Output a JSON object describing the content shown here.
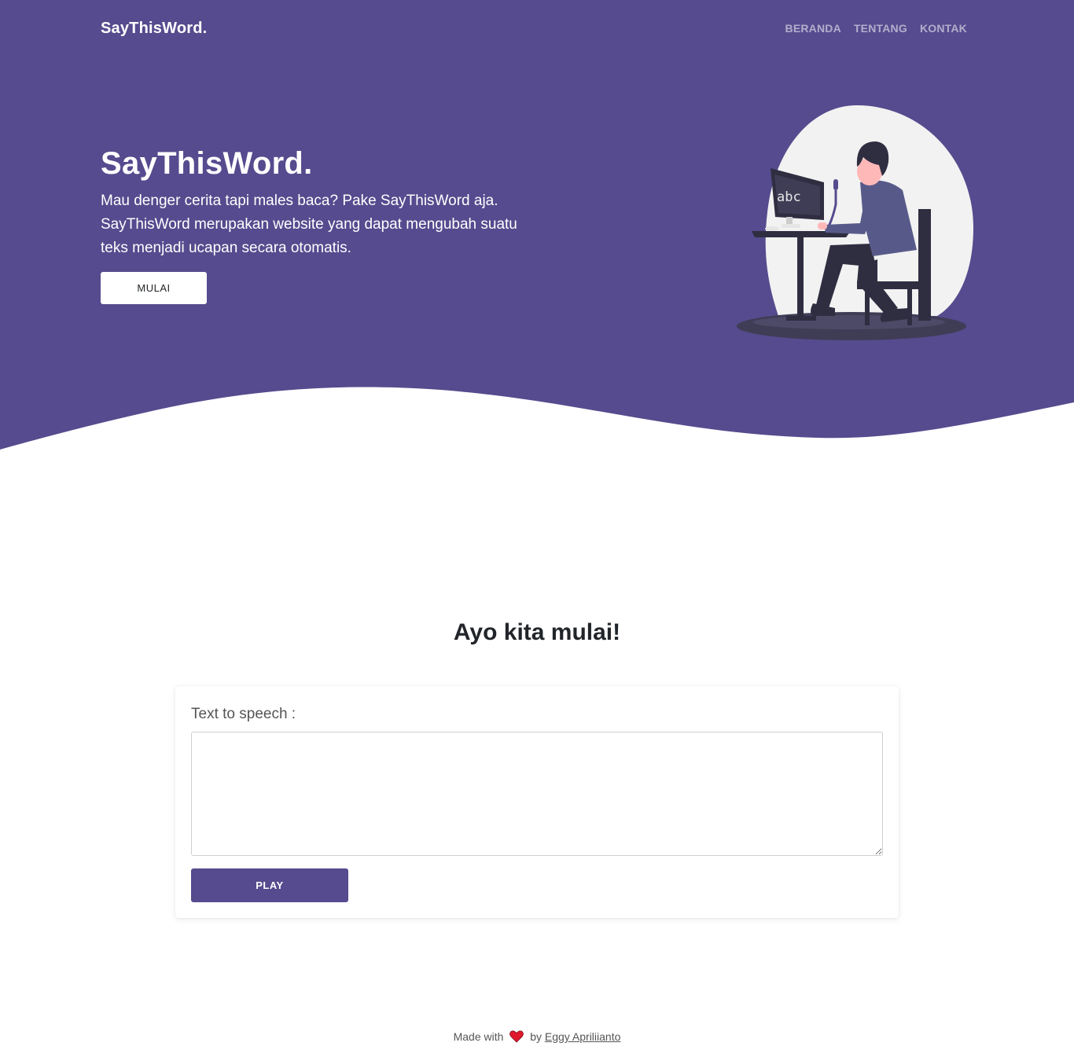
{
  "nav": {
    "brand": "SayThisWord.",
    "links": [
      "BERANDA",
      "TENTANG",
      "KONTAK"
    ]
  },
  "hero": {
    "title": "SayThisWord.",
    "description": "Mau denger cerita tapi males baca? Pake SayThisWord aja. SayThisWord merupakan website yang dapat mengubah suatu teks menjadi ucapan secara otomatis.",
    "cta_label": "MULAI",
    "illustration_screen_text": "abc"
  },
  "main": {
    "title": "Ayo kita mulai!",
    "input_label": "Text to speech :",
    "textarea_value": "",
    "play_label": "PLAY"
  },
  "footer": {
    "made_with": "Made with",
    "by": "by",
    "author": "Eggy Apriliianto"
  },
  "colors": {
    "primary": "#564b8e",
    "white": "#ffffff",
    "heart": "#e0182d"
  }
}
